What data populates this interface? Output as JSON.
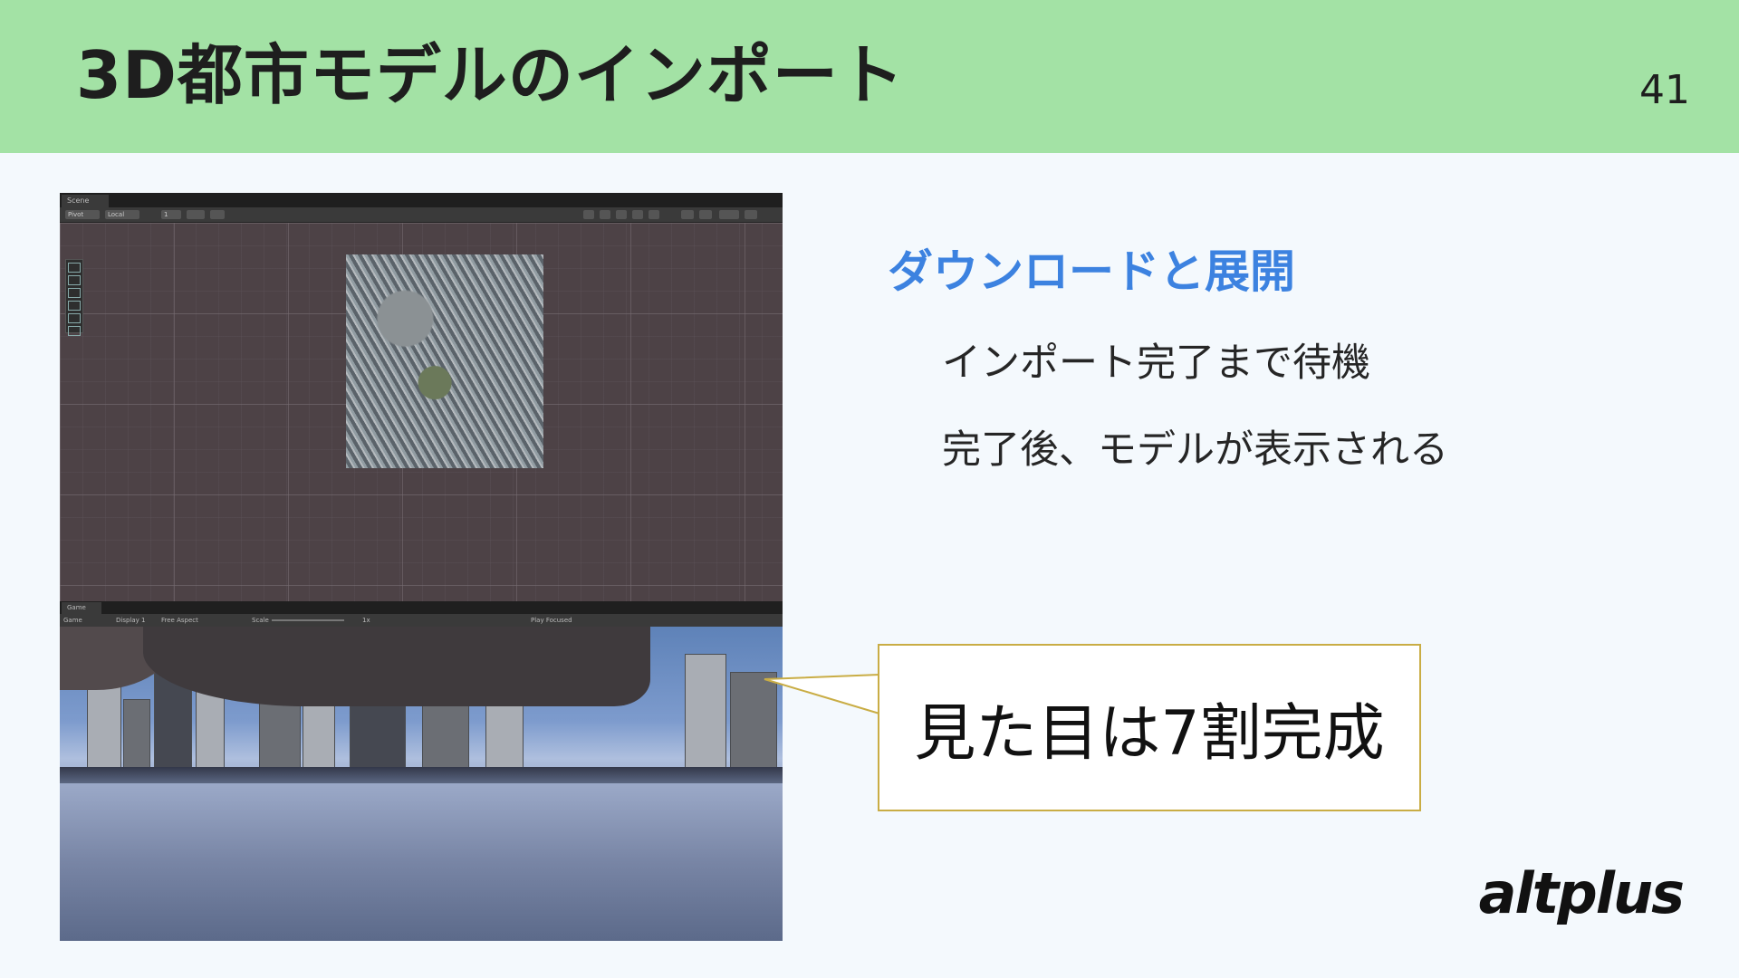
{
  "slide": {
    "title": "3D都市モデルのインポート",
    "page_number": "41"
  },
  "content": {
    "heading": "ダウンロードと展開",
    "bullets": [
      "インポート完了まで待機",
      "完了後、モデルが表示される"
    ]
  },
  "callout": {
    "text": "見た目は7割完成"
  },
  "unity": {
    "scene_tab": "Scene",
    "scene_toolbar": [
      "Pivot",
      "Local",
      "1"
    ],
    "game_tab": "Game",
    "game_toolbar": {
      "mode": "Game",
      "display": "Display 1",
      "aspect": "Free Aspect",
      "scale_label": "Scale",
      "scale_value": "1x",
      "play_mode": "Play Focused"
    }
  },
  "brand": {
    "logo_text": "altplus",
    "header_color": "#a3e2a5",
    "heading_color": "#3c82e0",
    "callout_border": "#c9ad45"
  }
}
